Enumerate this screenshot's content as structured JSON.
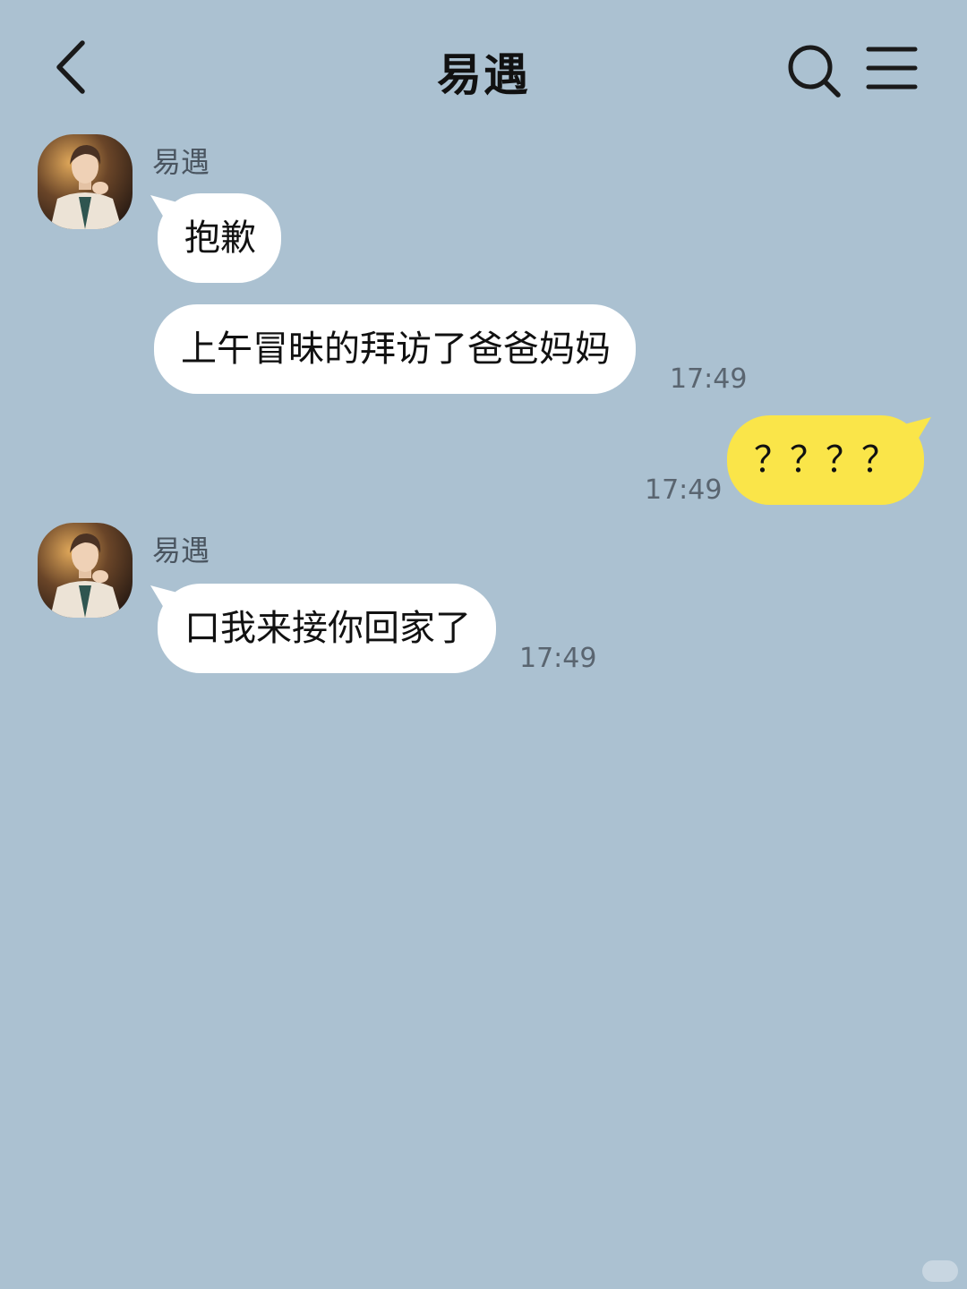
{
  "header": {
    "title": "易遇",
    "back_icon": "chevron-left-icon",
    "search_icon": "search-icon",
    "menu_icon": "menu-icon"
  },
  "colors": {
    "background": "#abc1d1",
    "incoming_bubble": "#ffffff",
    "outgoing_bubble": "#fae549"
  },
  "messages": [
    {
      "sender": "易遇",
      "direction": "incoming",
      "bubbles": [
        {
          "text": "抱歉",
          "time": ""
        },
        {
          "text": "上午冒昧的拜访了爸爸妈妈",
          "time": "17:49"
        }
      ]
    },
    {
      "sender": "",
      "direction": "outgoing",
      "bubbles": [
        {
          "text": "？？？？",
          "time": "17:49"
        }
      ]
    },
    {
      "sender": "易遇",
      "direction": "incoming",
      "bubbles": [
        {
          "text": "口我来接你回家了",
          "time": "17:49"
        }
      ]
    }
  ]
}
